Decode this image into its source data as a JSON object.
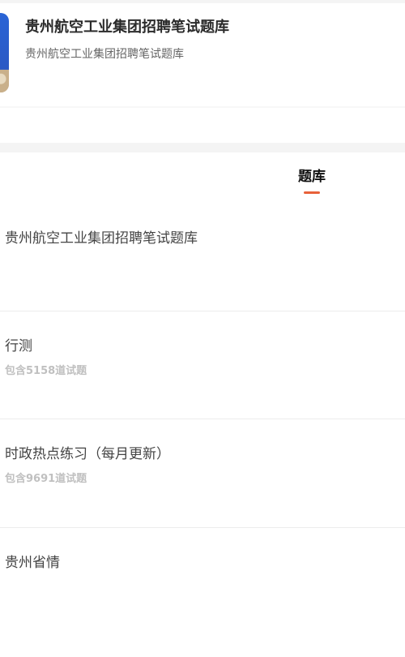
{
  "header": {
    "title": "贵州航空工业集团招聘笔试题库",
    "subtitle": "贵州航空工业集团招聘笔试题库"
  },
  "tabs": [
    {
      "label": "题库",
      "active": true
    }
  ],
  "accent_color": "#e8613a",
  "section_title": "贵州航空工业集团招聘笔试题库",
  "items": [
    {
      "title": "行测",
      "count": "包含5158道试题"
    },
    {
      "title": "时政热点练习（每月更新）",
      "count": "包含9691道试题"
    },
    {
      "title": "贵州省情",
      "count": ""
    }
  ]
}
